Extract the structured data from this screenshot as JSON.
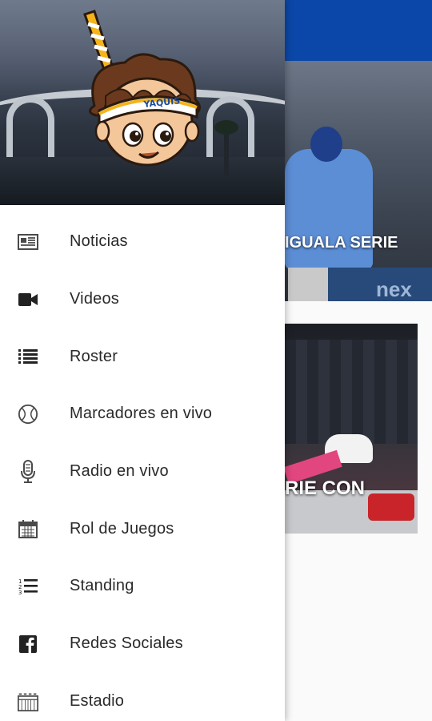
{
  "background": {
    "card1_headline": "IGUALA SERIE",
    "card1_ad_text": "nex  Comex",
    "card2_headline": "RIE CON"
  },
  "drawer": {
    "header": {
      "mascot_headband_text": "YAQUIS"
    },
    "menu": [
      {
        "label": "Noticias",
        "icon": "newspaper-icon"
      },
      {
        "label": "Videos",
        "icon": "videocam-icon"
      },
      {
        "label": "Roster",
        "icon": "list-icon"
      },
      {
        "label": "Marcadores en vivo",
        "icon": "baseball-icon"
      },
      {
        "label": "Radio en vivo",
        "icon": "microphone-icon"
      },
      {
        "label": "Rol de Juegos",
        "icon": "calendar-icon"
      },
      {
        "label": "Standing",
        "icon": "numbered-list-icon"
      },
      {
        "label": "Redes Sociales",
        "icon": "facebook-icon"
      },
      {
        "label": "Estadio",
        "icon": "stadium-icon"
      }
    ]
  },
  "colors": {
    "appbar": "#0b47a8",
    "icon": "#4a4a4a",
    "text": "#2a2a2a"
  }
}
